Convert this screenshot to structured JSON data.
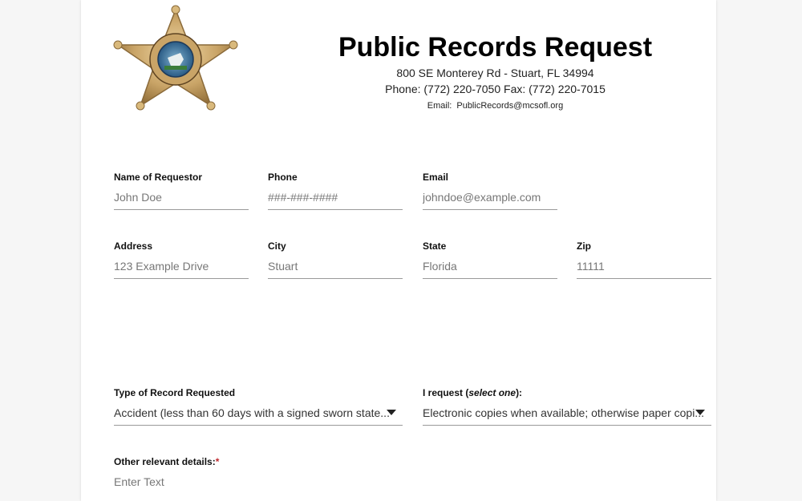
{
  "header": {
    "logo_name": "Martin County Sheriff's Office badge",
    "title": "Public Records Request",
    "address": "800 SE Monterey Rd - Stuart, FL 34994",
    "phone_fax": "Phone: (772) 220-7050 Fax: (772) 220-7015",
    "email_label": "Email:",
    "email_value": "PublicRecords@mcsofl.org"
  },
  "form": {
    "name": {
      "label": "Name of Requestor",
      "placeholder": "John Doe"
    },
    "phone": {
      "label": "Phone",
      "placeholder": "###-###-####"
    },
    "email": {
      "label": "Email",
      "placeholder": "johndoe@example.com"
    },
    "address": {
      "label": "Address",
      "placeholder": "123 Example Drive"
    },
    "city": {
      "label": "City",
      "placeholder": "Stuart"
    },
    "state": {
      "label": "State",
      "placeholder": "Florida"
    },
    "zip": {
      "label": "Zip",
      "placeholder": "11111"
    },
    "record_type": {
      "label": "Type of Record Requested",
      "selected": "Accident (less than 60 days with a signed sworn state..."
    },
    "request_format": {
      "label_prefix": "I request (",
      "label_em": "select one",
      "label_suffix": "):",
      "selected": "Electronic copies when available; otherwise paper copi..."
    },
    "details": {
      "label": "Other relevant details:",
      "required_mark": "*",
      "placeholder": "Enter Text"
    }
  },
  "colors": {
    "required": "#c0292f",
    "underline": "#9a9a9a",
    "background": "#f6f6f6"
  }
}
